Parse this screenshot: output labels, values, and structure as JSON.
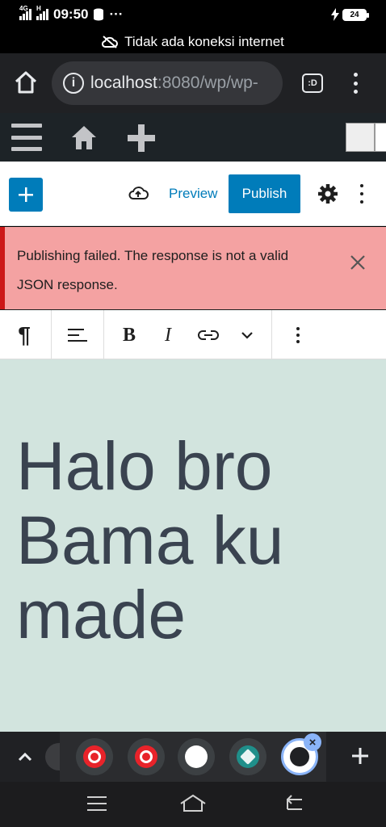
{
  "status_bar": {
    "time": "09:50",
    "network1": "4G",
    "network2": "H",
    "more": "···",
    "battery": "24"
  },
  "offline_banner": {
    "text": "Tidak ada koneksi internet"
  },
  "browser": {
    "url_host": "localhost",
    "url_rest": ":8080/wp/wp-",
    "tabs_label": ":D"
  },
  "editor": {
    "preview_label": "Preview",
    "publish_label": "Publish"
  },
  "notice": {
    "message": "Publishing failed. The response is not a valid JSON response."
  },
  "block_toolbar": {
    "paragraph": "¶",
    "bold": "B",
    "italic": "I"
  },
  "content": {
    "heading": "Halo bro Bama ku made"
  },
  "tab_strip": {
    "close_glyph": "×"
  },
  "colors": {
    "accent": "#007cba",
    "notice_bg": "#f4a2a2",
    "notice_border": "#cc1818",
    "canvas_bg": "#d2e4de",
    "admin_bar": "#1d2327"
  }
}
